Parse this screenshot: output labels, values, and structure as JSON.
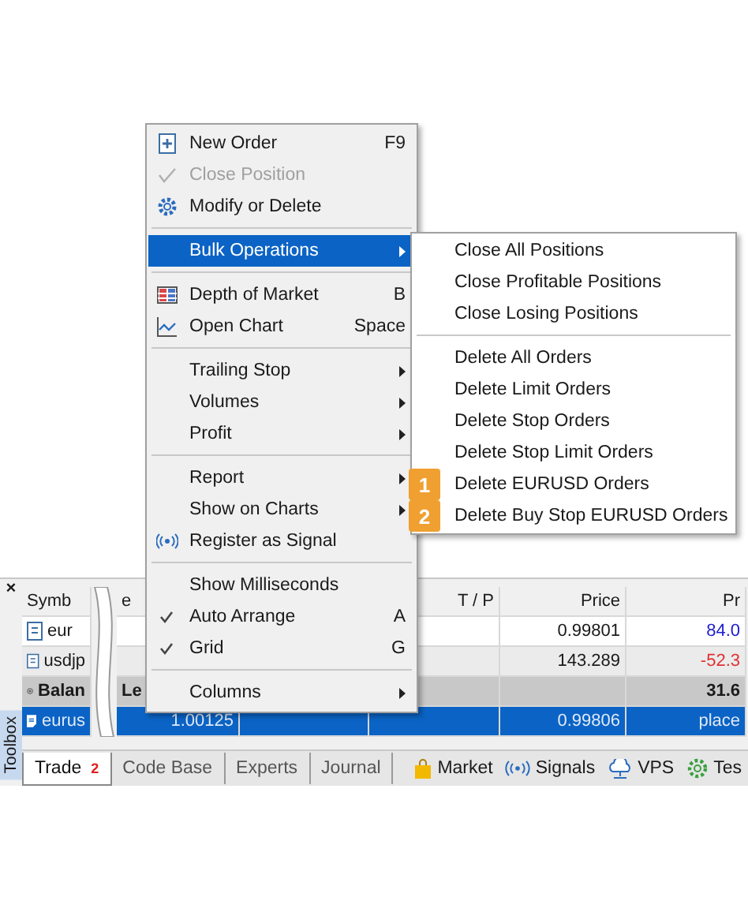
{
  "context_menu": {
    "items": [
      {
        "kind": "item",
        "label": "New Order",
        "shortcut": "F9",
        "submenu": false,
        "disabled": false,
        "selected": false,
        "checked": false
      },
      {
        "kind": "item",
        "label": "Close Position",
        "submenu": false,
        "disabled": true,
        "selected": false,
        "checked": false
      },
      {
        "kind": "item",
        "label": "Modify or Delete",
        "submenu": false,
        "disabled": false,
        "selected": false,
        "checked": false
      },
      {
        "kind": "separator"
      },
      {
        "kind": "item",
        "label": "Bulk Operations",
        "submenu": true,
        "disabled": false,
        "selected": true,
        "checked": false
      },
      {
        "kind": "separator"
      },
      {
        "kind": "item",
        "label": "Depth of Market",
        "shortcut": "B",
        "submenu": false,
        "disabled": false,
        "selected": false,
        "checked": false
      },
      {
        "kind": "item",
        "label": "Open Chart",
        "shortcut": "Space",
        "submenu": false,
        "disabled": false,
        "selected": false,
        "checked": false
      },
      {
        "kind": "separator"
      },
      {
        "kind": "item",
        "label": "Trailing Stop",
        "submenu": true,
        "disabled": false,
        "selected": false,
        "checked": false
      },
      {
        "kind": "item",
        "label": "Volumes",
        "submenu": true,
        "disabled": false,
        "selected": false,
        "checked": false
      },
      {
        "kind": "item",
        "label": "Profit",
        "submenu": true,
        "disabled": false,
        "selected": false,
        "checked": false
      },
      {
        "kind": "separator"
      },
      {
        "kind": "item",
        "label": "Report",
        "submenu": true,
        "disabled": false,
        "selected": false,
        "checked": false
      },
      {
        "kind": "item",
        "label": "Show on Charts",
        "submenu": true,
        "disabled": false,
        "selected": false,
        "checked": false
      },
      {
        "kind": "item",
        "label": "Register as Signal",
        "submenu": false,
        "disabled": false,
        "selected": false,
        "checked": false
      },
      {
        "kind": "separator"
      },
      {
        "kind": "item",
        "label": "Show Milliseconds",
        "submenu": false,
        "disabled": false,
        "selected": false,
        "checked": false
      },
      {
        "kind": "item",
        "label": "Auto Arrange",
        "shortcut": "A",
        "submenu": false,
        "disabled": false,
        "selected": false,
        "checked": true
      },
      {
        "kind": "item",
        "label": "Grid",
        "shortcut": "G",
        "submenu": false,
        "disabled": false,
        "selected": false,
        "checked": true
      },
      {
        "kind": "separator"
      },
      {
        "kind": "item",
        "label": "Columns",
        "submenu": true,
        "disabled": false,
        "selected": false,
        "checked": false
      }
    ]
  },
  "submenu": {
    "items": [
      {
        "kind": "item",
        "label": "Close All Positions"
      },
      {
        "kind": "item",
        "label": "Close Profitable Positions"
      },
      {
        "kind": "item",
        "label": "Close Losing Positions"
      },
      {
        "kind": "separator"
      },
      {
        "kind": "item",
        "label": "Delete All Orders"
      },
      {
        "kind": "item",
        "label": "Delete Limit Orders"
      },
      {
        "kind": "item",
        "label": "Delete Stop Orders"
      },
      {
        "kind": "item",
        "label": "Delete Stop Limit Orders"
      },
      {
        "kind": "item",
        "label": "Delete EURUSD Orders",
        "badge": "1"
      },
      {
        "kind": "item",
        "label": "Delete Buy Stop EURUSD Orders",
        "badge": "2"
      }
    ]
  },
  "terminal": {
    "close": "×",
    "sidebar_label": "Toolbox",
    "header": {
      "col_1": "Symb",
      "col_2": "e",
      "col_4": "T / P",
      "col_5": "Price",
      "col_6": "Pr"
    },
    "rows": [
      {
        "kind": "position",
        "selected": false,
        "cells": [
          "eur",
          null,
          null,
          null,
          "0.99801",
          "84.0"
        ],
        "color": "#2020d0"
      },
      {
        "kind": "position",
        "selected": false,
        "cells": [
          "usdjp",
          null,
          null,
          null,
          "143.289",
          "-52.3"
        ],
        "color": "#e03030"
      },
      {
        "kind": "balance",
        "selected": false,
        "cells": [
          "Balan",
          "Le",
          null,
          null,
          null,
          "31.6"
        ]
      },
      {
        "kind": "order",
        "selected": true,
        "cells": [
          "eurus",
          "1.00125",
          null,
          null,
          "0.99806",
          "place"
        ]
      }
    ],
    "tabs": [
      {
        "label": "Trade",
        "count": "2",
        "selected": true
      },
      {
        "label": "Code Base",
        "selected": false
      },
      {
        "label": "Experts",
        "selected": false
      },
      {
        "label": "Journal",
        "selected": false
      }
    ],
    "side_tabs": [
      {
        "label": "Market"
      },
      {
        "label": "Signals"
      },
      {
        "label": "VPS"
      },
      {
        "label": "Tes"
      }
    ]
  }
}
